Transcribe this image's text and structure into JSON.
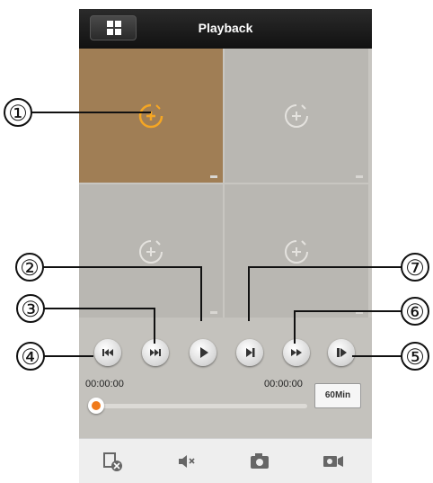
{
  "header": {
    "title": "Playback",
    "menu_icon": "grid-icon"
  },
  "channels": [
    {
      "id": 1,
      "selected": true,
      "icon": "add-channel-icon"
    },
    {
      "id": 2,
      "selected": false,
      "icon": "add-channel-icon"
    },
    {
      "id": 3,
      "selected": false,
      "icon": "add-channel-icon"
    },
    {
      "id": 4,
      "selected": false,
      "icon": "add-channel-icon"
    }
  ],
  "controls": {
    "buttons": [
      "previous-icon",
      "next-icon",
      "play-icon",
      "step-frame-icon",
      "fast-forward-icon",
      "slow-forward-icon"
    ],
    "start_time": "00:00:00",
    "end_time": "00:00:00",
    "duration_label": "60Min",
    "progress": 0
  },
  "toolbar": {
    "items": [
      "close-channel-icon",
      "mute-icon",
      "snapshot-icon",
      "record-icon"
    ]
  },
  "callouts": [
    "①",
    "②",
    "③",
    "④",
    "⑤",
    "⑥",
    "⑦"
  ],
  "colors": {
    "accent": "#f5a623",
    "selected_cell": "#a07e55",
    "progress_dot": "#f07a1a"
  }
}
